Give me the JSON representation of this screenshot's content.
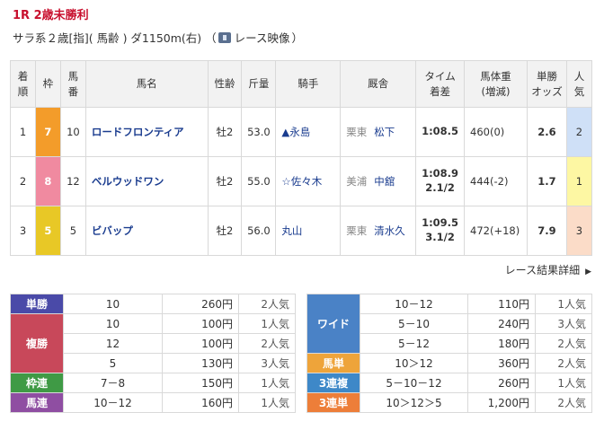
{
  "race": {
    "title": "1R 2歳未勝利",
    "info": "サラ系２歳[指]( 馬齢 ) ダ1150m(右) （",
    "video_label": "レース映像",
    "info_close": "）"
  },
  "table_headers": {
    "rank": [
      "着",
      "順"
    ],
    "waku": "枠",
    "num": [
      "馬",
      "番"
    ],
    "horse": "馬名",
    "sex_age": "性齢",
    "weight": "斤量",
    "jockey": "騎手",
    "trainer": "厩舎",
    "time": [
      "タイム",
      "着差"
    ],
    "horse_weight": [
      "馬体重",
      "(増減)"
    ],
    "odds": [
      "単勝",
      "オッズ"
    ],
    "pop": [
      "人",
      "気"
    ]
  },
  "rows": [
    {
      "rank": "1",
      "waku": "7",
      "num": "10",
      "horse": "ロードフロンティア",
      "sex_age": "牡2",
      "weight": "53.0",
      "jockey": "▲永島",
      "area": "栗東",
      "trainer": "松下",
      "time": "1:08.5",
      "margin": "",
      "horse_weight": "460(0)",
      "odds": "2.6",
      "pop": "2"
    },
    {
      "rank": "2",
      "waku": "8",
      "num": "12",
      "horse": "ベルウッドワン",
      "sex_age": "牡2",
      "weight": "55.0",
      "jockey": "☆佐々木",
      "area": "美浦",
      "trainer": "中舘",
      "time": "1:08.9",
      "margin": "2.1/2",
      "horse_weight": "444(-2)",
      "odds": "1.7",
      "pop": "1"
    },
    {
      "rank": "3",
      "waku": "5",
      "num": "5",
      "horse": "ビバップ",
      "sex_age": "牡2",
      "weight": "56.0",
      "jockey": "丸山",
      "area": "栗東",
      "trainer": "清水久",
      "time": "1:09.5",
      "margin": "3.1/2",
      "horse_weight": "472(+18)",
      "odds": "7.9",
      "pop": "3"
    }
  ],
  "detail_link": "レース結果詳細",
  "payouts_left": {
    "tansho": {
      "label": "単勝",
      "items": [
        {
          "combo": "10",
          "payout": "260円",
          "pop": "2人気"
        }
      ]
    },
    "fukusho": {
      "label": "複勝",
      "items": [
        {
          "combo": "10",
          "payout": "100円",
          "pop": "1人気"
        },
        {
          "combo": "12",
          "payout": "100円",
          "pop": "2人気"
        },
        {
          "combo": "5",
          "payout": "130円",
          "pop": "3人気"
        }
      ]
    },
    "wakuren": {
      "label": "枠連",
      "items": [
        {
          "combo": "7－8",
          "payout": "150円",
          "pop": "1人気"
        }
      ]
    },
    "umaren": {
      "label": "馬連",
      "items": [
        {
          "combo": "10－12",
          "payout": "160円",
          "pop": "1人気"
        }
      ]
    }
  },
  "payouts_right": {
    "wide": {
      "label": "ワイド",
      "items": [
        {
          "combo": "10－12",
          "payout": "110円",
          "pop": "1人気"
        },
        {
          "combo": "5－10",
          "payout": "240円",
          "pop": "3人気"
        },
        {
          "combo": "5－12",
          "payout": "180円",
          "pop": "2人気"
        }
      ]
    },
    "umatan": {
      "label": "馬単",
      "items": [
        {
          "combo": "10＞12",
          "payout": "360円",
          "pop": "2人気"
        }
      ]
    },
    "sanrenpuku": {
      "label": "3連複",
      "items": [
        {
          "combo": "5－10－12",
          "payout": "260円",
          "pop": "1人気"
        }
      ]
    },
    "sanrentan": {
      "label": "3連単",
      "items": [
        {
          "combo": "10＞12＞5",
          "payout": "1,200円",
          "pop": "2人気"
        }
      ]
    }
  },
  "colors": {
    "title_red": "#c8102e",
    "link_blue": "#1a3c8f",
    "waku7": "#f39c2a",
    "waku8": "#f08aa0",
    "waku5": "#e8c826"
  }
}
